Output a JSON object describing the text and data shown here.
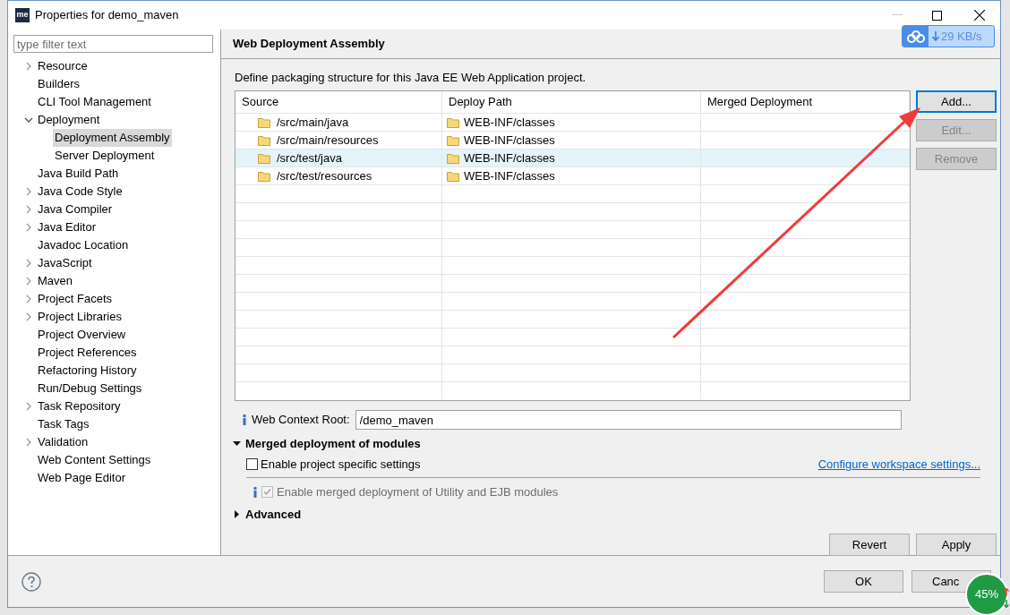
{
  "window": {
    "app_icon_text": "me",
    "title": "Properties for demo_maven"
  },
  "sidebar": {
    "filter": {
      "placeholder": "type filter text"
    },
    "items": [
      {
        "label": "Resource",
        "selected": false,
        "expanded": false
      },
      {
        "label": "Builders",
        "selected": false
      },
      {
        "label": "CLI Tool Management",
        "selected": false
      },
      {
        "label": "Deployment",
        "selected": false,
        "expanded": true,
        "children": [
          {
            "label": "Deployment Assembly",
            "selected": true
          },
          {
            "label": "Server Deployment",
            "selected": false
          }
        ]
      },
      {
        "label": "Java Build Path",
        "selected": false
      },
      {
        "label": "Java Code Style",
        "selected": false,
        "expanded": false
      },
      {
        "label": "Java Compiler",
        "selected": false,
        "expanded": false
      },
      {
        "label": "Java Editor",
        "selected": false,
        "expanded": false
      },
      {
        "label": "Javadoc Location",
        "selected": false
      },
      {
        "label": "JavaScript",
        "selected": false,
        "expanded": false
      },
      {
        "label": "Maven",
        "selected": false,
        "expanded": false
      },
      {
        "label": "Project Facets",
        "selected": false,
        "expanded": false
      },
      {
        "label": "Project Libraries",
        "selected": false,
        "expanded": false
      },
      {
        "label": "Project Overview",
        "selected": false
      },
      {
        "label": "Project References",
        "selected": false
      },
      {
        "label": "Refactoring History",
        "selected": false
      },
      {
        "label": "Run/Debug Settings",
        "selected": false
      },
      {
        "label": "Task Repository",
        "selected": false,
        "expanded": false
      },
      {
        "label": "Task Tags",
        "selected": false
      },
      {
        "label": "Validation",
        "selected": false,
        "expanded": false
      },
      {
        "label": "Web Content Settings",
        "selected": false
      },
      {
        "label": "Web Page Editor",
        "selected": false
      }
    ]
  },
  "page": {
    "title": "Web Deployment Assembly",
    "description": "Define packaging structure for this Java EE Web Application project."
  },
  "table": {
    "columns": [
      "Source",
      "Deploy Path",
      "Merged Deployment"
    ],
    "rows": [
      {
        "source": "/src/main/java",
        "deploy_path": "WEB-INF/classes",
        "selected": false
      },
      {
        "source": "/src/main/resources",
        "deploy_path": "WEB-INF/classes",
        "selected": false
      },
      {
        "source": "/src/test/java",
        "deploy_path": "WEB-INF/classes",
        "selected": true
      },
      {
        "source": "/src/test/resources",
        "deploy_path": "WEB-INF/classes",
        "selected": false
      }
    ]
  },
  "side_buttons": [
    {
      "label": "Add...",
      "disabled": false,
      "focused": true
    },
    {
      "label": "Edit...",
      "disabled": true,
      "focused": false
    },
    {
      "label": "Remove",
      "disabled": true,
      "focused": false
    }
  ],
  "context_root": {
    "label": "Web Context Root:",
    "value": "/demo_maven"
  },
  "merged_section": {
    "title": "Merged deployment of modules",
    "expanded": true,
    "project_setting": {
      "label": "Enable project specific settings",
      "checked": false
    },
    "link": "Configure workspace settings...",
    "merge_option": {
      "label": "Enable merged deployment of Utility and EJB modules",
      "checked": true,
      "disabled": true
    }
  },
  "advanced_section": {
    "title": "Advanced",
    "expanded": false
  },
  "page_buttons": [
    "Revert",
    "Apply"
  ],
  "dialog_buttons": [
    "OK",
    "Canc"
  ],
  "network_widget": {
    "speed": "29 KB/s"
  },
  "memory_ball": {
    "reading": "45%"
  }
}
